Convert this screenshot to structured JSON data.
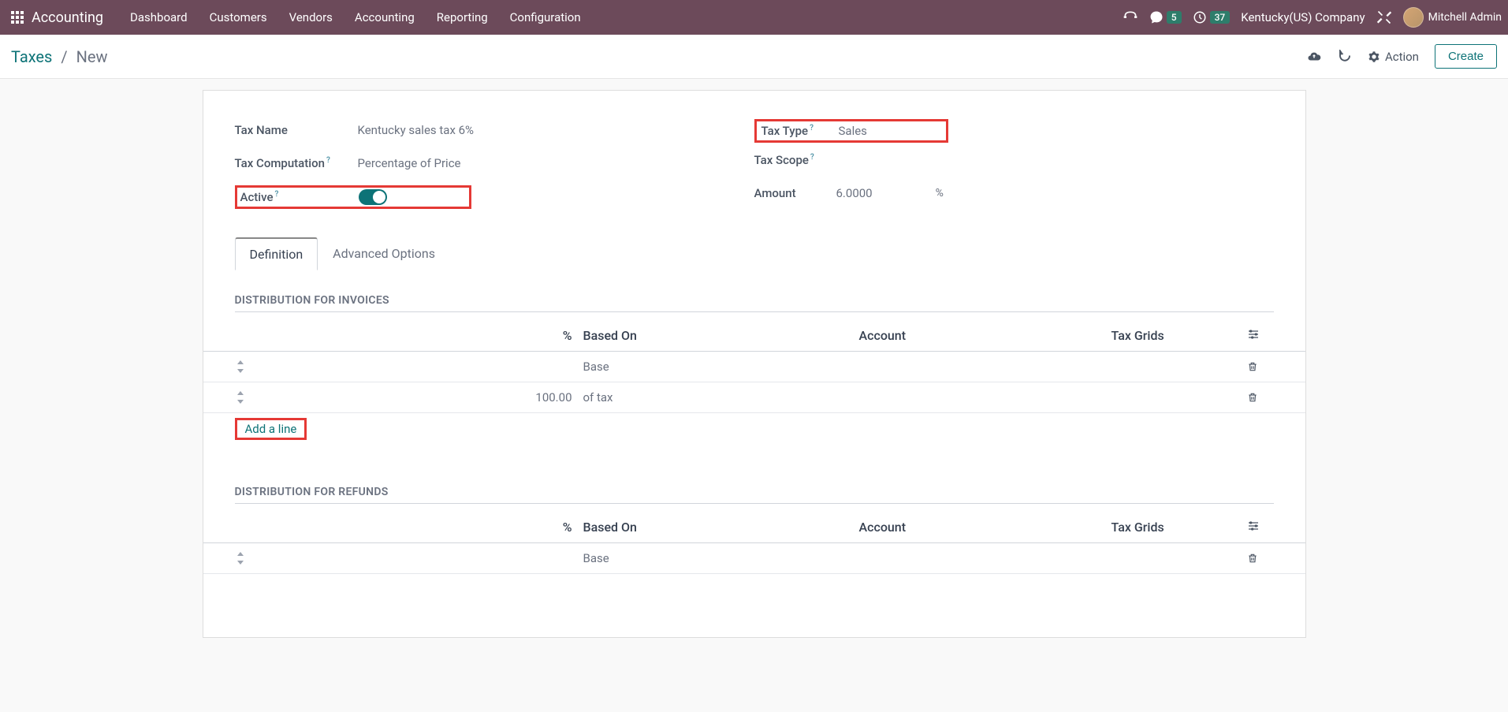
{
  "topbar": {
    "brand": "Accounting",
    "menu": [
      "Dashboard",
      "Customers",
      "Vendors",
      "Accounting",
      "Reporting",
      "Configuration"
    ],
    "messages_badge": "5",
    "activities_badge": "37",
    "company": "Kentucky(US) Company",
    "user": "Mitchell Admin"
  },
  "breadcrumb": {
    "parent": "Taxes",
    "current": "New"
  },
  "actions": {
    "action_label": "Action",
    "create_label": "Create"
  },
  "form": {
    "left": {
      "tax_name_label": "Tax Name",
      "tax_name_value": "Kentucky sales tax 6%",
      "tax_computation_label": "Tax Computation",
      "tax_computation_value": "Percentage of Price",
      "active_label": "Active"
    },
    "right": {
      "tax_type_label": "Tax Type",
      "tax_type_value": "Sales",
      "tax_scope_label": "Tax Scope",
      "amount_label": "Amount",
      "amount_value": "6.0000",
      "amount_unit": "%"
    }
  },
  "tabs": {
    "definition": "Definition",
    "advanced": "Advanced Options"
  },
  "sections": {
    "invoices_title": "DISTRIBUTION FOR INVOICES",
    "refunds_title": "DISTRIBUTION FOR REFUNDS",
    "columns": {
      "pct": "%",
      "based_on": "Based On",
      "account": "Account",
      "tax_grids": "Tax Grids"
    },
    "invoices_rows": [
      {
        "pct": "",
        "based_on": "Base"
      },
      {
        "pct": "100.00",
        "based_on": "of tax"
      }
    ],
    "refunds_rows": [
      {
        "pct": "",
        "based_on": "Base"
      }
    ],
    "add_line": "Add a line"
  }
}
